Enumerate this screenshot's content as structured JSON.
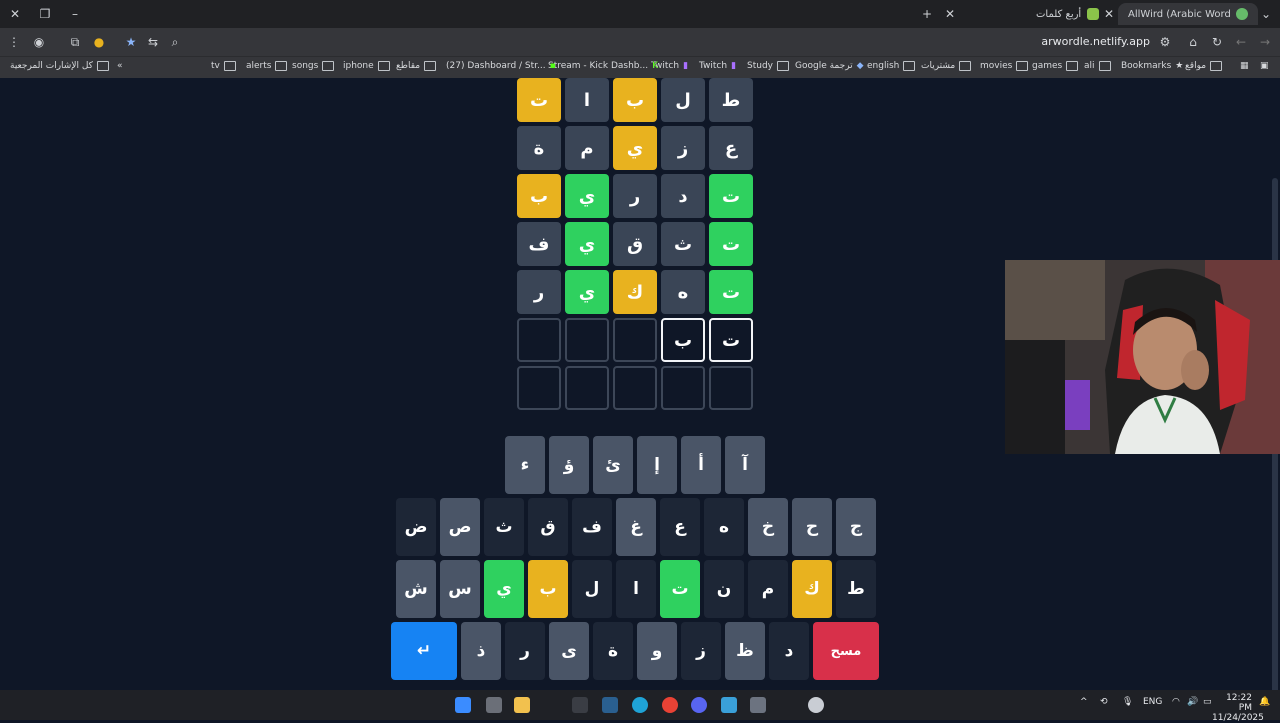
{
  "browser": {
    "tabs": [
      {
        "title": "AllWird (Arabic Wordle) - الورد",
        "active": true
      },
      {
        "title": "أربع كلمات",
        "active": false
      }
    ],
    "url": "arwordle.netlify.app",
    "bookmarks": [
      "مواقع",
      "Bookmarks",
      "ali",
      "games",
      "movies",
      "مشتريات",
      "english",
      "Google ترجمة",
      "Study",
      "Twitch",
      "Twitch",
      "Stream - Kick Dashb...",
      "(27) Dashboard / Str...",
      "مقاطع",
      "iphone",
      "songs",
      "alerts",
      "tv",
      "كل الإشارات المرجعية"
    ]
  },
  "board": {
    "rows": [
      [
        {
          "l": "ط",
          "s": "absent"
        },
        {
          "l": "ل",
          "s": "absent"
        },
        {
          "l": "ب",
          "s": "present"
        },
        {
          "l": "ا",
          "s": "absent"
        },
        {
          "l": "ت",
          "s": "present"
        }
      ],
      [
        {
          "l": "ع",
          "s": "absent"
        },
        {
          "l": "ز",
          "s": "absent"
        },
        {
          "l": "ي",
          "s": "present"
        },
        {
          "l": "م",
          "s": "absent"
        },
        {
          "l": "ة",
          "s": "absent"
        }
      ],
      [
        {
          "l": "ت",
          "s": "correct"
        },
        {
          "l": "د",
          "s": "absent"
        },
        {
          "l": "ر",
          "s": "absent"
        },
        {
          "l": "ي",
          "s": "correct"
        },
        {
          "l": "ب",
          "s": "present"
        }
      ],
      [
        {
          "l": "ت",
          "s": "correct"
        },
        {
          "l": "ث",
          "s": "absent"
        },
        {
          "l": "ق",
          "s": "absent"
        },
        {
          "l": "ي",
          "s": "correct"
        },
        {
          "l": "ف",
          "s": "absent"
        }
      ],
      [
        {
          "l": "ت",
          "s": "correct"
        },
        {
          "l": "ه",
          "s": "absent"
        },
        {
          "l": "ك",
          "s": "present"
        },
        {
          "l": "ي",
          "s": "correct"
        },
        {
          "l": "ر",
          "s": "absent"
        }
      ],
      [
        {
          "l": "ت",
          "s": "typed"
        },
        {
          "l": "ب",
          "s": "typed"
        },
        {
          "l": "",
          "s": "empty"
        },
        {
          "l": "",
          "s": "empty"
        },
        {
          "l": "",
          "s": "empty"
        }
      ],
      [
        {
          "l": "",
          "s": "empty"
        },
        {
          "l": "",
          "s": "empty"
        },
        {
          "l": "",
          "s": "empty"
        },
        {
          "l": "",
          "s": "empty"
        },
        {
          "l": "",
          "s": "empty"
        }
      ]
    ]
  },
  "keyboard": {
    "row1": [
      {
        "l": "آ",
        "s": "absent"
      },
      {
        "l": "أ",
        "s": "absent"
      },
      {
        "l": "إ",
        "s": "absent"
      },
      {
        "l": "ئ",
        "s": "absent"
      },
      {
        "l": "ؤ",
        "s": "absent"
      },
      {
        "l": "ء",
        "s": "absent"
      }
    ],
    "row2": [
      {
        "l": "ج",
        "s": "absent"
      },
      {
        "l": "ح",
        "s": "absent"
      },
      {
        "l": "خ",
        "s": "absent"
      },
      {
        "l": "ه",
        "s": "default"
      },
      {
        "l": "ع",
        "s": "default"
      },
      {
        "l": "غ",
        "s": "absent"
      },
      {
        "l": "ف",
        "s": "default"
      },
      {
        "l": "ق",
        "s": "default"
      },
      {
        "l": "ث",
        "s": "default"
      },
      {
        "l": "ص",
        "s": "absent"
      },
      {
        "l": "ض",
        "s": "default"
      }
    ],
    "row3": [
      {
        "l": "ط",
        "s": "default"
      },
      {
        "l": "ك",
        "s": "present"
      },
      {
        "l": "م",
        "s": "default"
      },
      {
        "l": "ن",
        "s": "default"
      },
      {
        "l": "ت",
        "s": "correct"
      },
      {
        "l": "ا",
        "s": "default"
      },
      {
        "l": "ل",
        "s": "default"
      },
      {
        "l": "ب",
        "s": "present"
      },
      {
        "l": "ي",
        "s": "correct"
      },
      {
        "l": "س",
        "s": "absent"
      },
      {
        "l": "ش",
        "s": "absent"
      }
    ],
    "row4": [
      {
        "l": "مسح",
        "s": "delete"
      },
      {
        "l": "د",
        "s": "default"
      },
      {
        "l": "ظ",
        "s": "absent"
      },
      {
        "l": "ز",
        "s": "default"
      },
      {
        "l": "و",
        "s": "absent"
      },
      {
        "l": "ة",
        "s": "default"
      },
      {
        "l": "ى",
        "s": "absent"
      },
      {
        "l": "ر",
        "s": "default"
      },
      {
        "l": "ذ",
        "s": "absent"
      },
      {
        "l": "↵",
        "s": "enter"
      }
    ]
  },
  "taskbar": {
    "lang": "ENG",
    "time": "12:22 PM",
    "date": "11/24/2025"
  },
  "colors": {
    "correct": "#2fd15f",
    "present": "#e8b21f",
    "absent": "#3a4556",
    "enter": "#1683f3",
    "delete": "#d8304a"
  }
}
